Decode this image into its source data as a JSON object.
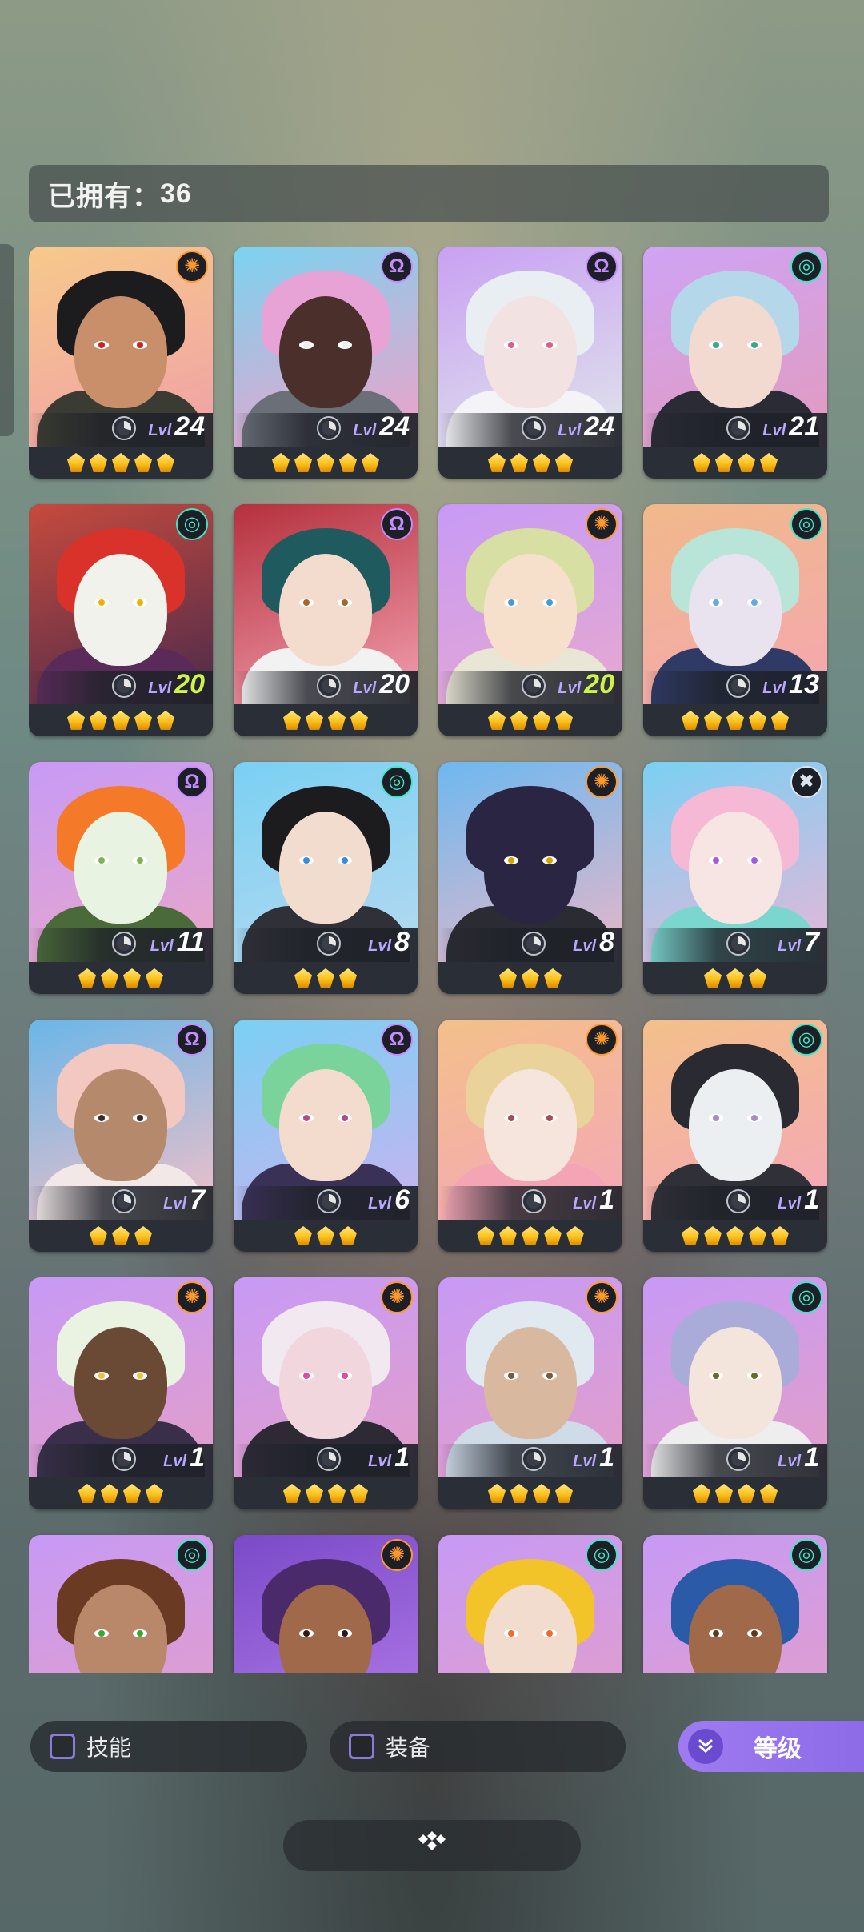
{
  "header": {
    "owned_label": "已拥有：",
    "owned_count": "36"
  },
  "level_label": "Lvl",
  "colors": {
    "accent": "#9e7bf0",
    "star": "#ffc21c",
    "faction_orange": "#ff9a2a",
    "faction_purple": "#c58bff",
    "faction_teal": "#3ee6c8",
    "faction_silver": "#d8e4f0"
  },
  "heroes": [
    {
      "level": "24",
      "stars": 5,
      "faction": "sun",
      "level_color": "white"
    },
    {
      "level": "24",
      "stars": 5,
      "faction": "omega",
      "level_color": "white"
    },
    {
      "level": "24",
      "stars": 4,
      "faction": "omega",
      "level_color": "white"
    },
    {
      "level": "21",
      "stars": 4,
      "faction": "swirl",
      "level_color": "white"
    },
    {
      "level": "20",
      "stars": 5,
      "faction": "swirl",
      "level_color": "green"
    },
    {
      "level": "20",
      "stars": 4,
      "faction": "omega",
      "level_color": "white"
    },
    {
      "level": "20",
      "stars": 4,
      "faction": "sun",
      "level_color": "green"
    },
    {
      "level": "13",
      "stars": 5,
      "faction": "swirl",
      "level_color": "white"
    },
    {
      "level": "11",
      "stars": 4,
      "faction": "omega",
      "level_color": "white"
    },
    {
      "level": "8",
      "stars": 3,
      "faction": "swirl",
      "level_color": "white"
    },
    {
      "level": "8",
      "stars": 3,
      "faction": "sun",
      "level_color": "white"
    },
    {
      "level": "7",
      "stars": 3,
      "faction": "cross",
      "level_color": "white"
    },
    {
      "level": "7",
      "stars": 3,
      "faction": "omega",
      "level_color": "white"
    },
    {
      "level": "6",
      "stars": 3,
      "faction": "omega",
      "level_color": "white"
    },
    {
      "level": "1",
      "stars": 5,
      "faction": "sun",
      "level_color": "white"
    },
    {
      "level": "1",
      "stars": 5,
      "faction": "swirl",
      "level_color": "white"
    },
    {
      "level": "1",
      "stars": 4,
      "faction": "sun",
      "level_color": "white"
    },
    {
      "level": "1",
      "stars": 4,
      "faction": "sun",
      "level_color": "white"
    },
    {
      "level": "1",
      "stars": 4,
      "faction": "sun",
      "level_color": "white"
    },
    {
      "level": "1",
      "stars": 4,
      "faction": "swirl",
      "level_color": "white"
    },
    {
      "level": null,
      "stars": 0,
      "faction": "swirl",
      "level_color": "white"
    },
    {
      "level": null,
      "stars": 0,
      "faction": "sun",
      "level_color": "white"
    },
    {
      "level": null,
      "stars": 0,
      "faction": "swirl",
      "level_color": "white"
    },
    {
      "level": null,
      "stars": 0,
      "faction": "swirl",
      "level_color": "white"
    }
  ],
  "portraits": [
    {
      "bg": [
        "#f7c98a",
        "#f0a0a8"
      ],
      "hair": "#1c1c1f",
      "skin": "#c98f6b",
      "body": "#3a3b32",
      "iris": "#c22"
    },
    {
      "bg": [
        "#7ad3f0",
        "#f3a0c8"
      ],
      "hair": "#e7a3d6",
      "skin": "#4a2f2a",
      "body": "#6a6f78",
      "iris": "#eee"
    },
    {
      "bg": [
        "#c9a0f3",
        "#dfe5ea"
      ],
      "hair": "#e9eef3",
      "skin": "#f3e2e2",
      "body": "#f4f4f6",
      "iris": "#e05b8a"
    },
    {
      "bg": [
        "#cfa3f5",
        "#e29bbd"
      ],
      "hair": "#b4d8ea",
      "skin": "#f2dad0",
      "body": "#2a2b35",
      "iris": "#3a8"
    },
    {
      "bg": [
        "#c64a3d",
        "#4a2a4b"
      ],
      "hair": "#d8322a",
      "skin": "#f2f2ec",
      "body": "#5a2b5a",
      "iris": "#f0b000"
    },
    {
      "bg": [
        "#b5303d",
        "#f3a0b0"
      ],
      "hair": "#1f5a5e",
      "skin": "#f3dccd",
      "body": "#f2f2f2",
      "iris": "#a8672a"
    },
    {
      "bg": [
        "#c79af6",
        "#e7a9cf"
      ],
      "hair": "#d7dfa3",
      "skin": "#f6e0cc",
      "body": "#e9e6d6",
      "iris": "#4a9ad6"
    },
    {
      "bg": [
        "#f0b98a",
        "#f5a7b0"
      ],
      "hair": "#b8e5d8",
      "skin": "#e9e3f0",
      "body": "#2f3a66",
      "iris": "#6ad"
    },
    {
      "bg": [
        "#c79af6",
        "#e9a7c8"
      ],
      "hair": "#f47a2a",
      "skin": "#e9f3e2",
      "body": "#4a6a3a",
      "iris": "#7cb54a"
    },
    {
      "bg": [
        "#7ad0f3",
        "#b6d9f0"
      ],
      "hair": "#1c1c1f",
      "skin": "#f2dccd",
      "body": "#2f3038",
      "iris": "#3a8ae0"
    },
    {
      "bg": [
        "#6db8f0",
        "#e8b7c8"
      ],
      "hair": "#2a2542",
      "skin": "#2a2542",
      "body": "#2a2b33",
      "iris": "#d8a300"
    },
    {
      "bg": [
        "#7ad0f3",
        "#e8b7d8"
      ],
      "hair": "#f5b9d6",
      "skin": "#f6e5e2",
      "body": "#7ad6cf",
      "iris": "#a45ae0"
    },
    {
      "bg": [
        "#6ab6e8",
        "#f3c0c8"
      ],
      "hair": "#f2c8c0",
      "skin": "#b58a6c",
      "body": "#f2e8e8",
      "iris": "#3a2a2a"
    },
    {
      "bg": [
        "#7ad0f3",
        "#c9b3f0"
      ],
      "hair": "#7ad39a",
      "skin": "#f3dccd",
      "body": "#3a3156",
      "iris": "#b24a8a"
    },
    {
      "bg": [
        "#f3c08a",
        "#f5a7b8"
      ],
      "hair": "#ead39a",
      "skin": "#f6e5dc",
      "body": "#f3a5b5",
      "iris": "#a84a5a"
    },
    {
      "bg": [
        "#f3c08a",
        "#f5a7b8"
      ],
      "hair": "#2a2a32",
      "skin": "#eceff2",
      "body": "#2f3038",
      "iris": "#a8c"
    },
    {
      "bg": [
        "#c79af6",
        "#e39ec8"
      ],
      "hair": "#eaf3e2",
      "skin": "#6a4a35",
      "body": "#3a2f4b",
      "iris": "#f0c040"
    },
    {
      "bg": [
        "#c79af6",
        "#e39ec8"
      ],
      "hair": "#f2e9f0",
      "skin": "#f1d6dd",
      "body": "#2d2a36",
      "iris": "#e04aa0"
    },
    {
      "bg": [
        "#c79af6",
        "#e39ec8"
      ],
      "hair": "#e0e9f0",
      "skin": "#d9b8a0",
      "body": "#cfdce8",
      "iris": "#7a5a3a"
    },
    {
      "bg": [
        "#c79af6",
        "#e39ec8"
      ],
      "hair": "#a9acd8",
      "skin": "#f3e5dc",
      "body": "#eeeeee",
      "iris": "#6a6a2a"
    },
    {
      "bg": [
        "#c79af6",
        "#e39ec8"
      ],
      "hair": "#6a3a22",
      "skin": "#b9876a",
      "body": "#c8c5c2",
      "iris": "#3a3"
    },
    {
      "bg": [
        "#7a4ac8",
        "#b27ae8"
      ],
      "hair": "#4a2a6a",
      "skin": "#a06a4a",
      "body": "#2a2336",
      "iris": "#2a1a1a"
    },
    {
      "bg": [
        "#c79af6",
        "#e39ec8"
      ],
      "hair": "#f2c42a",
      "skin": "#f2dccd",
      "body": "#3a3a3a",
      "iris": "#f06a2a"
    },
    {
      "bg": [
        "#c79af6",
        "#e39ec8"
      ],
      "hair": "#2a5aa8",
      "skin": "#a06a4a",
      "body": "#2a3a6a",
      "iris": "#5a3a1a"
    }
  ],
  "filters": {
    "skill_label": "技能",
    "equip_label": "装备",
    "sort_label": "等级",
    "sort_icon": "chevron-double-down-icon"
  },
  "bottom_button_icon": "diamond-cluster-icon"
}
